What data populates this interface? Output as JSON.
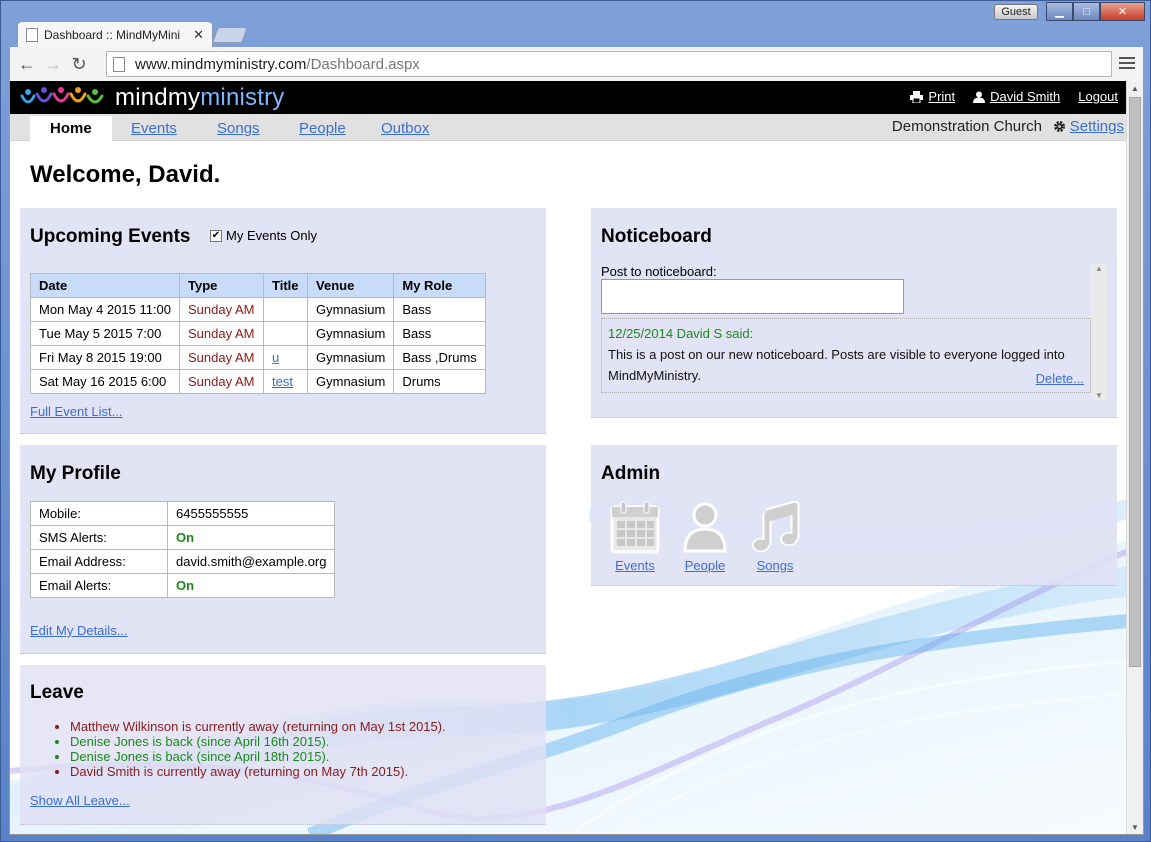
{
  "browser": {
    "tab_title": "Dashboard :: MindMyMini",
    "tab_close": "✕",
    "guest_label": "Guest",
    "url_host": "www.mindmyministry.com",
    "url_path": "/Dashboard.aspx"
  },
  "header": {
    "logo_main": "mindmy",
    "logo_accent": "ministry",
    "print_label": "Print",
    "user_label": "David Smith",
    "logout_label": "Logout"
  },
  "nav": {
    "home": "Home",
    "events": "Events",
    "songs": "Songs",
    "people": "People",
    "outbox": "Outbox",
    "church": "Demonstration Church",
    "settings": "Settings"
  },
  "welcome": "Welcome, David.",
  "events": {
    "title": "Upcoming Events",
    "my_events_only_label": "My Events Only",
    "my_events_only_checked": true,
    "columns": [
      "Date",
      "Type",
      "Title",
      "Venue",
      "My Role"
    ],
    "rows": [
      {
        "date": "Mon May 4 2015 11:00",
        "type": "Sunday AM",
        "title": "",
        "venue": "Gymnasium",
        "role": "Bass"
      },
      {
        "date": "Tue May 5 2015 7:00",
        "type": "Sunday AM",
        "title": "",
        "venue": "Gymnasium",
        "role": "Bass"
      },
      {
        "date": "Fri May 8 2015 19:00",
        "type": "Sunday AM",
        "title": "u",
        "venue": "Gymnasium",
        "role": "Bass ,Drums"
      },
      {
        "date": "Sat May 16 2015 6:00",
        "type": "Sunday AM",
        "title": "test",
        "venue": "Gymnasium",
        "role": "Drums"
      }
    ],
    "full_list_link": "Full Event List..."
  },
  "profile": {
    "title": "My Profile",
    "rows": [
      {
        "label": "Mobile:",
        "value": "6455555555"
      },
      {
        "label": "SMS Alerts:",
        "value": "On"
      },
      {
        "label": "Email Address:",
        "value": "david.smith@example.org"
      },
      {
        "label": "Email Alerts:",
        "value": "On"
      }
    ],
    "edit_link": "Edit My Details..."
  },
  "leave": {
    "title": "Leave",
    "items": [
      {
        "text": "Matthew Wilkinson is currently away (returning on May 1st 2015).",
        "status": "away"
      },
      {
        "text": "Denise Jones is back (since April 16th 2015).",
        "status": "back"
      },
      {
        "text": "Denise Jones is back (since April 18th 2015).",
        "status": "back"
      },
      {
        "text": "David Smith is currently away (returning on May 7th 2015).",
        "status": "away"
      }
    ],
    "show_all_link": "Show All Leave..."
  },
  "noticeboard": {
    "title": "Noticeboard",
    "post_label": "Post to noticeboard:",
    "post_value": "",
    "posts": [
      {
        "meta": "12/25/2014 David S said:",
        "body": "This is a post on our new noticeboard. Posts are visible to everyone logged into MindMyMinistry.",
        "delete_label": "Delete..."
      }
    ]
  },
  "admin": {
    "title": "Admin",
    "items": [
      {
        "label": "Events",
        "icon": "calendar-icon"
      },
      {
        "label": "People",
        "icon": "person-icon"
      },
      {
        "label": "Songs",
        "icon": "music-note-icon"
      }
    ]
  },
  "colors": {
    "header_bg": "#000000",
    "link": "#3a6fd0",
    "panel_bg": "#e0e1f4",
    "table_header": "#c8dbf8",
    "status_on": "#1a8a1a",
    "status_away": "#8b1a1a"
  }
}
